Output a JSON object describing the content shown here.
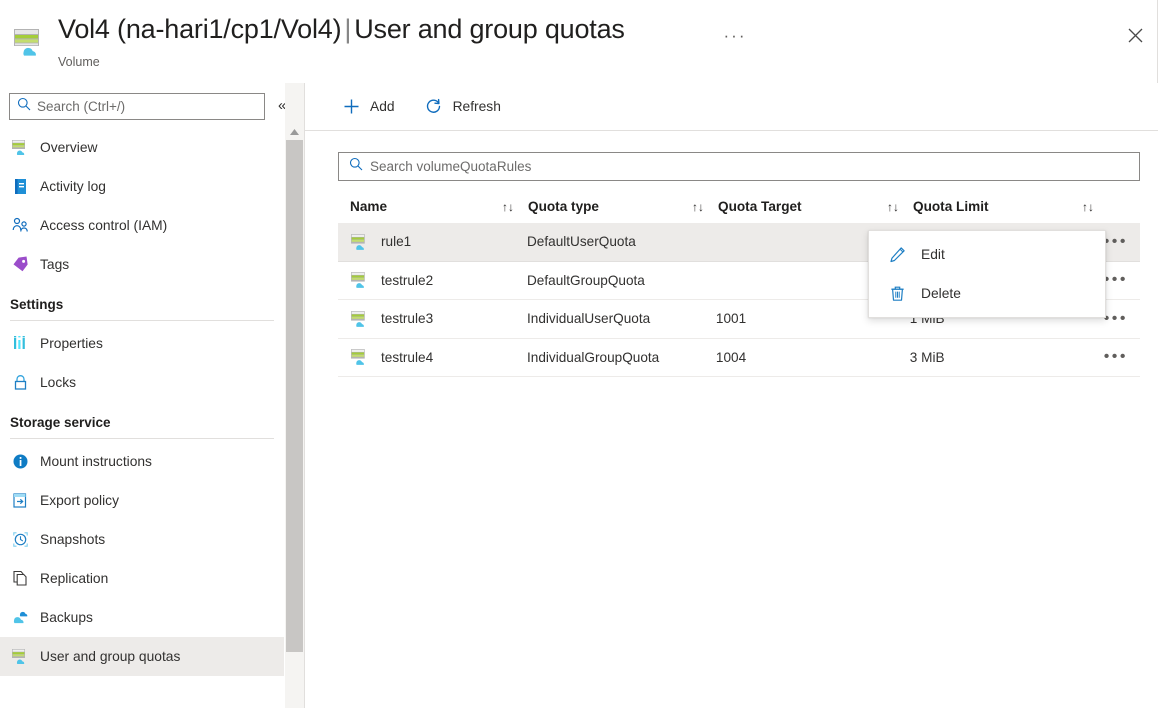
{
  "header": {
    "title_resource": "Vol4 (na-hari1/cp1/Vol4)",
    "title_separator": "|",
    "title_page": "User and group quotas",
    "subtitle": "Volume",
    "ellipsis": "···",
    "close_label": "Close",
    "icon": "volume-icon"
  },
  "sidebar": {
    "search": {
      "placeholder": "Search (Ctrl+/)",
      "value": "",
      "icon": "search-icon"
    },
    "collapse": {
      "label": "«",
      "icon": "chevron-double-left-icon"
    },
    "items": [
      {
        "label": "Overview",
        "icon": "volume-icon",
        "selected": false
      },
      {
        "label": "Activity log",
        "icon": "activity-log-icon",
        "selected": false
      },
      {
        "label": "Access control (IAM)",
        "icon": "access-control-icon",
        "selected": false
      },
      {
        "label": "Tags",
        "icon": "tag-icon",
        "selected": false
      }
    ],
    "groups": [
      {
        "title": "Settings",
        "items": [
          {
            "label": "Properties",
            "icon": "properties-icon",
            "selected": false
          },
          {
            "label": "Locks",
            "icon": "lock-icon",
            "selected": false
          }
        ]
      },
      {
        "title": "Storage service",
        "items": [
          {
            "label": "Mount instructions",
            "icon": "info-icon",
            "selected": false
          },
          {
            "label": "Export policy",
            "icon": "export-policy-icon",
            "selected": false
          },
          {
            "label": "Snapshots",
            "icon": "snapshot-clock-icon",
            "selected": false
          },
          {
            "label": "Replication",
            "icon": "replication-copy-icon",
            "selected": false
          },
          {
            "label": "Backups",
            "icon": "backup-cloud-icon",
            "selected": false
          },
          {
            "label": "User and group quotas",
            "icon": "volume-icon",
            "selected": true
          }
        ]
      }
    ],
    "scrollbar": {
      "up_arrow": "▲"
    }
  },
  "toolbar": {
    "add_label": "Add",
    "add_icon": "plus-icon",
    "refresh_label": "Refresh",
    "refresh_icon": "refresh-icon"
  },
  "filter": {
    "placeholder": "Search volumeQuotaRules",
    "value": "",
    "icon": "search-icon"
  },
  "table": {
    "columns": [
      {
        "label": "Name",
        "sort_icon": "↑↓"
      },
      {
        "label": "Quota type",
        "sort_icon": "↑↓"
      },
      {
        "label": "Quota Target",
        "sort_icon": "↑↓"
      },
      {
        "label": "Quota Limit",
        "sort_icon": "↑↓"
      }
    ],
    "more_glyph": "•••",
    "rows": [
      {
        "name": "rule1",
        "quota_type": "DefaultUserQuota",
        "quota_target": "",
        "quota_limit": "",
        "selected": true,
        "icon": "volume-icon"
      },
      {
        "name": "testrule2",
        "quota_type": "DefaultGroupQuota",
        "quota_target": "",
        "quota_limit": "",
        "selected": false,
        "icon": "volume-icon"
      },
      {
        "name": "testrule3",
        "quota_type": "IndividualUserQuota",
        "quota_target": "1001",
        "quota_limit": "1 MiB",
        "selected": false,
        "icon": "volume-icon"
      },
      {
        "name": "testrule4",
        "quota_type": "IndividualGroupQuota",
        "quota_target": "1004",
        "quota_limit": "3 MiB",
        "selected": false,
        "icon": "volume-icon"
      }
    ]
  },
  "context_menu": {
    "items": [
      {
        "label": "Edit",
        "icon": "pencil-icon"
      },
      {
        "label": "Delete",
        "icon": "trash-icon"
      }
    ]
  },
  "colors": {
    "accent": "#0078d4",
    "selected_row": "#edebe9",
    "border": "#e1dfdd",
    "text": "#323130"
  }
}
